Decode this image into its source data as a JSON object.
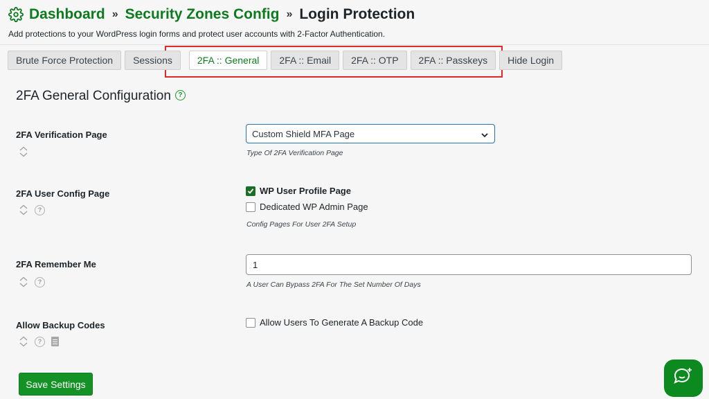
{
  "header": {
    "crumbs": [
      "Dashboard",
      "Security Zones Config",
      "Login Protection"
    ],
    "separator": "»",
    "subtitle": "Add protections to your WordPress login forms and protect user accounts with 2-Factor Authentication."
  },
  "tabs": [
    {
      "label": "Brute Force Protection",
      "active": false
    },
    {
      "label": "Sessions",
      "active": false
    },
    {
      "label": "2FA :: General",
      "active": true
    },
    {
      "label": "2FA :: Email",
      "active": false
    },
    {
      "label": "2FA :: OTP",
      "active": false
    },
    {
      "label": "2FA :: Passkeys",
      "active": false
    },
    {
      "label": "Hide Login",
      "active": false
    }
  ],
  "section": {
    "title": "2FA General Configuration",
    "help": "?"
  },
  "settings": {
    "verification_page": {
      "label": "2FA Verification Page",
      "selected": "Custom Shield MFA Page",
      "help": "Type Of 2FA Verification Page"
    },
    "user_config_page": {
      "label": "2FA User Config Page",
      "options": [
        {
          "label": "WP User Profile Page",
          "checked": true
        },
        {
          "label": "Dedicated WP Admin Page",
          "checked": false
        }
      ],
      "help": "Config Pages For User 2FA Setup"
    },
    "remember_me": {
      "label": "2FA Remember Me",
      "value": "1",
      "help": "A User Can Bypass 2FA For The Set Number Of Days"
    },
    "backup_codes": {
      "label": "Allow Backup Codes",
      "option": "Allow Users To Generate A Backup Code",
      "checked": false
    }
  },
  "save_label": "Save Settings",
  "colors": {
    "brand_green": "#0d7a1e",
    "highlight_red": "#e02a2a",
    "focus_blue": "#2271b1"
  },
  "icons": [
    "gear-icon",
    "help-icon",
    "sort-icon",
    "doc-icon",
    "chevron-down-icon",
    "chat-icon"
  ]
}
